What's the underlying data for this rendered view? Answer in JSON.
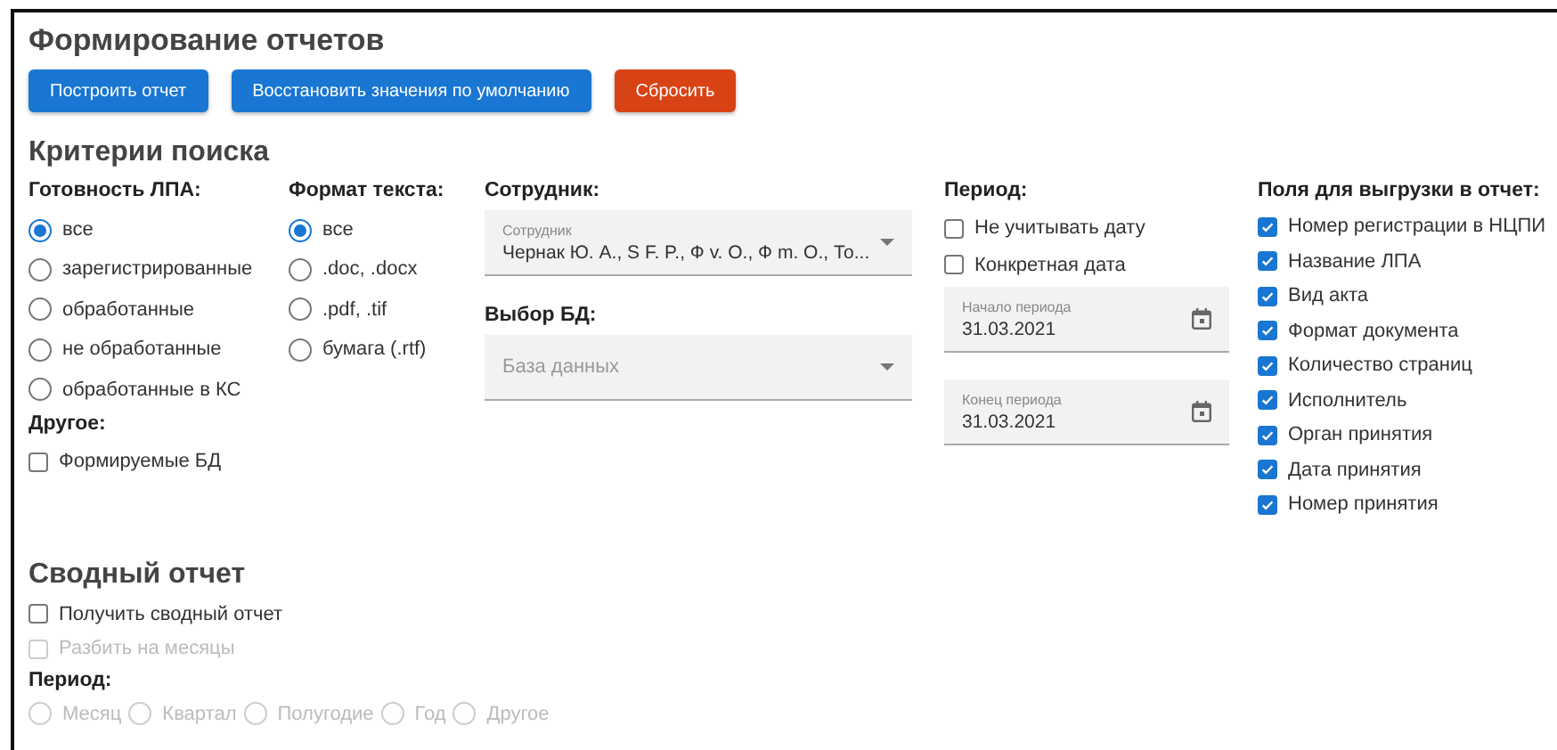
{
  "title": "Формирование отчетов",
  "buttons": [
    {
      "label": "Построить отчет",
      "kind": "primary"
    },
    {
      "label": "Восстановить значения по умолчанию",
      "kind": "primary"
    },
    {
      "label": "Сбросить",
      "kind": "danger"
    }
  ],
  "search_criteria": {
    "title": "Критерии поиска",
    "readiness": {
      "label": "Готовность ЛПА:",
      "options": [
        {
          "label": "все",
          "selected": true
        },
        {
          "label": "зарегистрированные",
          "selected": false
        },
        {
          "label": "обработанные",
          "selected": false
        },
        {
          "label": "не обработанные",
          "selected": false
        },
        {
          "label": "обработанные в КС",
          "selected": false
        }
      ]
    },
    "other": {
      "label": "Другое:",
      "options": [
        {
          "label": "Формируемые БД",
          "checked": false
        }
      ]
    },
    "text_format": {
      "label": "Формат текста:",
      "options": [
        {
          "label": "все",
          "selected": true
        },
        {
          "label": ".doc, .docx",
          "selected": false
        },
        {
          "label": ".pdf, .tif",
          "selected": false
        },
        {
          "label": "бумага (.rtf)",
          "selected": false
        }
      ]
    },
    "employee": {
      "label": "Сотрудник:",
      "field": {
        "floating_label": "Сотрудник",
        "value": "Чернак Ю. А., S F. P., Ф v. O., Ф m. O., То..."
      }
    },
    "database": {
      "label": "Выбор БД:",
      "field": {
        "placeholder": "База данных"
      }
    },
    "period": {
      "label": "Период:",
      "options": [
        {
          "label": "Не учитывать дату",
          "checked": false
        },
        {
          "label": "Конкретная дата",
          "checked": false
        }
      ],
      "start": {
        "floating_label": "Начало периода",
        "value": "31.03.2021"
      },
      "end": {
        "floating_label": "Конец периода",
        "value": "31.03.2021"
      }
    },
    "export_fields": {
      "label": "Поля для выгрузки в отчет:",
      "options": [
        {
          "label": "Номер регистрации в НЦПИ",
          "checked": true
        },
        {
          "label": "Название ЛПА",
          "checked": true
        },
        {
          "label": "Вид акта",
          "checked": true
        },
        {
          "label": "Формат документа",
          "checked": true
        },
        {
          "label": "Количество страниц",
          "checked": true
        },
        {
          "label": "Исполнитель",
          "checked": true
        },
        {
          "label": "Орган принятия",
          "checked": true
        },
        {
          "label": "Дата принятия",
          "checked": true
        },
        {
          "label": "Номер принятия",
          "checked": true
        }
      ]
    }
  },
  "summary": {
    "title": "Сводный отчет",
    "options": [
      {
        "label": "Получить сводный отчет",
        "checked": false,
        "disabled": false
      },
      {
        "label": "Разбить на месяцы",
        "checked": false,
        "disabled": true
      }
    ],
    "period": {
      "label": "Период:",
      "options": [
        {
          "label": "Месяц",
          "selected": false,
          "disabled": true
        },
        {
          "label": "Квартал",
          "selected": false,
          "disabled": true
        },
        {
          "label": "Полугодие",
          "selected": false,
          "disabled": true
        },
        {
          "label": "Год",
          "selected": false,
          "disabled": true
        },
        {
          "label": "Другое",
          "selected": false,
          "disabled": true
        }
      ]
    }
  }
}
